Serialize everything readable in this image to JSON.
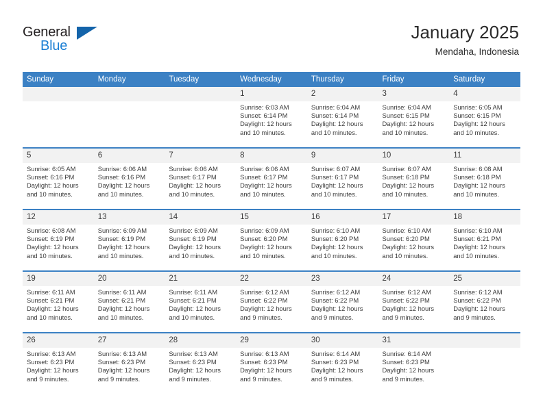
{
  "brand": {
    "name_part1": "General",
    "name_part2": "Blue",
    "triangle_icon": "triangle-icon",
    "primary_color": "#1464aa",
    "accent_color": "#1b7fd4"
  },
  "header": {
    "title": "January 2025",
    "subtitle": "Mendaha, Indonesia"
  },
  "calendar": {
    "header_bg": "#3c81c4",
    "daynum_bg": "#f2f2f2",
    "weekdays": [
      "Sunday",
      "Monday",
      "Tuesday",
      "Wednesday",
      "Thursday",
      "Friday",
      "Saturday"
    ],
    "weeks": [
      [
        {
          "day": "",
          "empty": true
        },
        {
          "day": "",
          "empty": true
        },
        {
          "day": "",
          "empty": true
        },
        {
          "day": "1",
          "sunrise": "Sunrise: 6:03 AM",
          "sunset": "Sunset: 6:14 PM",
          "daylight1": "Daylight: 12 hours",
          "daylight2": "and 10 minutes."
        },
        {
          "day": "2",
          "sunrise": "Sunrise: 6:04 AM",
          "sunset": "Sunset: 6:14 PM",
          "daylight1": "Daylight: 12 hours",
          "daylight2": "and 10 minutes."
        },
        {
          "day": "3",
          "sunrise": "Sunrise: 6:04 AM",
          "sunset": "Sunset: 6:15 PM",
          "daylight1": "Daylight: 12 hours",
          "daylight2": "and 10 minutes."
        },
        {
          "day": "4",
          "sunrise": "Sunrise: 6:05 AM",
          "sunset": "Sunset: 6:15 PM",
          "daylight1": "Daylight: 12 hours",
          "daylight2": "and 10 minutes."
        }
      ],
      [
        {
          "day": "5",
          "sunrise": "Sunrise: 6:05 AM",
          "sunset": "Sunset: 6:16 PM",
          "daylight1": "Daylight: 12 hours",
          "daylight2": "and 10 minutes."
        },
        {
          "day": "6",
          "sunrise": "Sunrise: 6:06 AM",
          "sunset": "Sunset: 6:16 PM",
          "daylight1": "Daylight: 12 hours",
          "daylight2": "and 10 minutes."
        },
        {
          "day": "7",
          "sunrise": "Sunrise: 6:06 AM",
          "sunset": "Sunset: 6:17 PM",
          "daylight1": "Daylight: 12 hours",
          "daylight2": "and 10 minutes."
        },
        {
          "day": "8",
          "sunrise": "Sunrise: 6:06 AM",
          "sunset": "Sunset: 6:17 PM",
          "daylight1": "Daylight: 12 hours",
          "daylight2": "and 10 minutes."
        },
        {
          "day": "9",
          "sunrise": "Sunrise: 6:07 AM",
          "sunset": "Sunset: 6:17 PM",
          "daylight1": "Daylight: 12 hours",
          "daylight2": "and 10 minutes."
        },
        {
          "day": "10",
          "sunrise": "Sunrise: 6:07 AM",
          "sunset": "Sunset: 6:18 PM",
          "daylight1": "Daylight: 12 hours",
          "daylight2": "and 10 minutes."
        },
        {
          "day": "11",
          "sunrise": "Sunrise: 6:08 AM",
          "sunset": "Sunset: 6:18 PM",
          "daylight1": "Daylight: 12 hours",
          "daylight2": "and 10 minutes."
        }
      ],
      [
        {
          "day": "12",
          "sunrise": "Sunrise: 6:08 AM",
          "sunset": "Sunset: 6:19 PM",
          "daylight1": "Daylight: 12 hours",
          "daylight2": "and 10 minutes."
        },
        {
          "day": "13",
          "sunrise": "Sunrise: 6:09 AM",
          "sunset": "Sunset: 6:19 PM",
          "daylight1": "Daylight: 12 hours",
          "daylight2": "and 10 minutes."
        },
        {
          "day": "14",
          "sunrise": "Sunrise: 6:09 AM",
          "sunset": "Sunset: 6:19 PM",
          "daylight1": "Daylight: 12 hours",
          "daylight2": "and 10 minutes."
        },
        {
          "day": "15",
          "sunrise": "Sunrise: 6:09 AM",
          "sunset": "Sunset: 6:20 PM",
          "daylight1": "Daylight: 12 hours",
          "daylight2": "and 10 minutes."
        },
        {
          "day": "16",
          "sunrise": "Sunrise: 6:10 AM",
          "sunset": "Sunset: 6:20 PM",
          "daylight1": "Daylight: 12 hours",
          "daylight2": "and 10 minutes."
        },
        {
          "day": "17",
          "sunrise": "Sunrise: 6:10 AM",
          "sunset": "Sunset: 6:20 PM",
          "daylight1": "Daylight: 12 hours",
          "daylight2": "and 10 minutes."
        },
        {
          "day": "18",
          "sunrise": "Sunrise: 6:10 AM",
          "sunset": "Sunset: 6:21 PM",
          "daylight1": "Daylight: 12 hours",
          "daylight2": "and 10 minutes."
        }
      ],
      [
        {
          "day": "19",
          "sunrise": "Sunrise: 6:11 AM",
          "sunset": "Sunset: 6:21 PM",
          "daylight1": "Daylight: 12 hours",
          "daylight2": "and 10 minutes."
        },
        {
          "day": "20",
          "sunrise": "Sunrise: 6:11 AM",
          "sunset": "Sunset: 6:21 PM",
          "daylight1": "Daylight: 12 hours",
          "daylight2": "and 10 minutes."
        },
        {
          "day": "21",
          "sunrise": "Sunrise: 6:11 AM",
          "sunset": "Sunset: 6:21 PM",
          "daylight1": "Daylight: 12 hours",
          "daylight2": "and 10 minutes."
        },
        {
          "day": "22",
          "sunrise": "Sunrise: 6:12 AM",
          "sunset": "Sunset: 6:22 PM",
          "daylight1": "Daylight: 12 hours",
          "daylight2": "and 9 minutes."
        },
        {
          "day": "23",
          "sunrise": "Sunrise: 6:12 AM",
          "sunset": "Sunset: 6:22 PM",
          "daylight1": "Daylight: 12 hours",
          "daylight2": "and 9 minutes."
        },
        {
          "day": "24",
          "sunrise": "Sunrise: 6:12 AM",
          "sunset": "Sunset: 6:22 PM",
          "daylight1": "Daylight: 12 hours",
          "daylight2": "and 9 minutes."
        },
        {
          "day": "25",
          "sunrise": "Sunrise: 6:12 AM",
          "sunset": "Sunset: 6:22 PM",
          "daylight1": "Daylight: 12 hours",
          "daylight2": "and 9 minutes."
        }
      ],
      [
        {
          "day": "26",
          "sunrise": "Sunrise: 6:13 AM",
          "sunset": "Sunset: 6:23 PM",
          "daylight1": "Daylight: 12 hours",
          "daylight2": "and 9 minutes."
        },
        {
          "day": "27",
          "sunrise": "Sunrise: 6:13 AM",
          "sunset": "Sunset: 6:23 PM",
          "daylight1": "Daylight: 12 hours",
          "daylight2": "and 9 minutes."
        },
        {
          "day": "28",
          "sunrise": "Sunrise: 6:13 AM",
          "sunset": "Sunset: 6:23 PM",
          "daylight1": "Daylight: 12 hours",
          "daylight2": "and 9 minutes."
        },
        {
          "day": "29",
          "sunrise": "Sunrise: 6:13 AM",
          "sunset": "Sunset: 6:23 PM",
          "daylight1": "Daylight: 12 hours",
          "daylight2": "and 9 minutes."
        },
        {
          "day": "30",
          "sunrise": "Sunrise: 6:14 AM",
          "sunset": "Sunset: 6:23 PM",
          "daylight1": "Daylight: 12 hours",
          "daylight2": "and 9 minutes."
        },
        {
          "day": "31",
          "sunrise": "Sunrise: 6:14 AM",
          "sunset": "Sunset: 6:23 PM",
          "daylight1": "Daylight: 12 hours",
          "daylight2": "and 9 minutes."
        },
        {
          "day": "",
          "empty": true
        }
      ]
    ]
  }
}
